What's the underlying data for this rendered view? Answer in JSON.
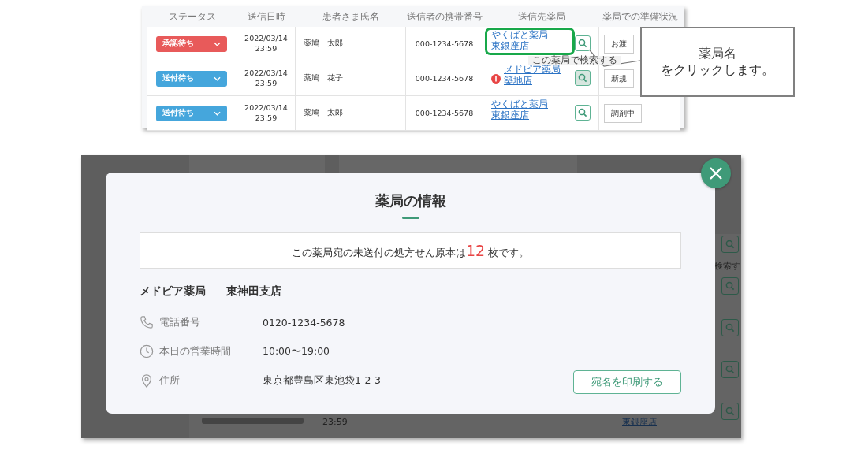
{
  "list_screenshot": {
    "columns": [
      "ステータス",
      "送信日時",
      "患者さま氏名",
      "送信者の携帯番号",
      "送信先薬局",
      "薬局での準備状況"
    ],
    "rows": [
      {
        "status": "承認待ち",
        "color": "#e85a5a",
        "date": "2022/03/14",
        "time": "23:59",
        "patient": "薬鳩　太郎",
        "phone": "000-1234-5678",
        "pharmacy": "やくばと薬局",
        "branch": "東銀座店",
        "warning": false,
        "highlighted": true,
        "search_active": false,
        "prep": "お渡"
      },
      {
        "status": "送付待ち",
        "color": "#45a6dc",
        "date": "2022/03/14",
        "time": "23:59",
        "patient": "薬鳩　花子",
        "phone": "000-1234-5678",
        "pharmacy": "メドピア薬局",
        "branch": "築地店",
        "warning": true,
        "highlighted": false,
        "search_active": true,
        "prep": "新規"
      },
      {
        "status": "送付待ち",
        "color": "#45a6dc",
        "date": "2022/03/14",
        "time": "23:59",
        "patient": "薬鳩　太郎",
        "phone": "000-1234-5678",
        "pharmacy": "やくばと薬局",
        "branch": "東銀座店",
        "warning": false,
        "highlighted": false,
        "search_active": false,
        "prep": "調剤中"
      }
    ],
    "tooltip": "この薬局で検索する"
  },
  "callout": {
    "lines": [
      "薬局名",
      "をクリックします。"
    ]
  },
  "background_page": {
    "time": "23:59",
    "link": "東銀座店",
    "tooltip_fragment": "検索す"
  },
  "modal": {
    "title": "薬局の情報",
    "notice_before": "この薬局宛の未送付の処方せん原本は",
    "count": "12",
    "notice_after": "枚です。",
    "name": "メドピア薬局",
    "branch": "東神田支店",
    "fields": [
      {
        "kind": "phone",
        "label": "電話番号",
        "value": "0120-1234-5678"
      },
      {
        "kind": "clock",
        "label": "本日の営業時間",
        "value": "10:00〜19:00"
      },
      {
        "kind": "pin",
        "label": "住所",
        "value": "東京都豊島区東池袋1-2-3"
      }
    ],
    "button": "宛名を印刷する"
  }
}
